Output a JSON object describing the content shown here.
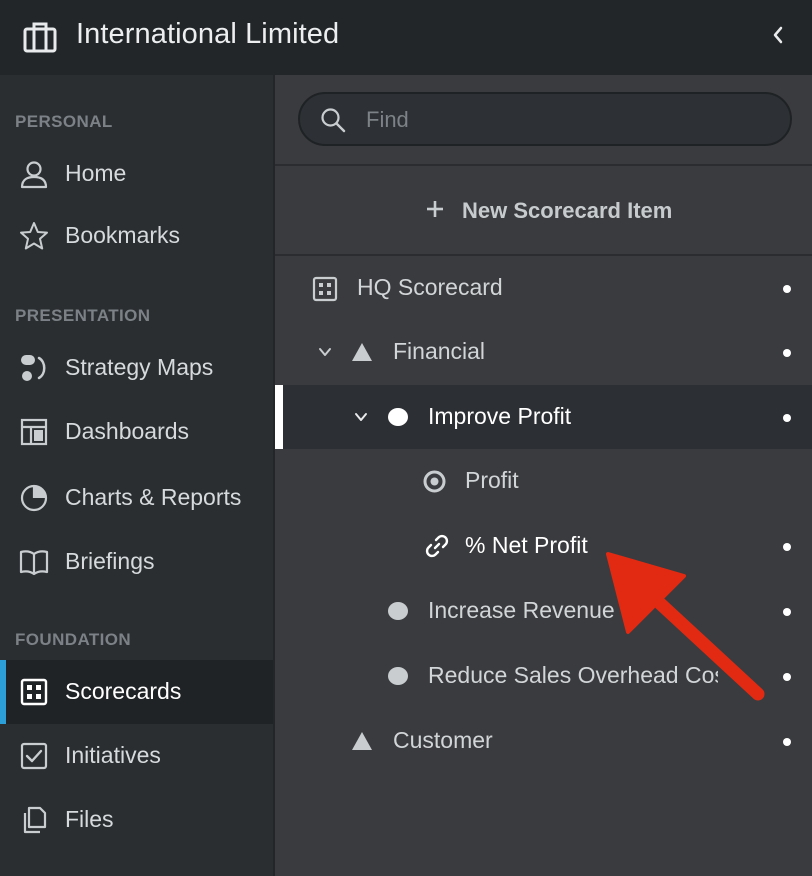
{
  "header": {
    "title": "International Limited",
    "app_icon": "briefcase-icon",
    "collapse_icon": "chevron-left-icon"
  },
  "sidebar": {
    "sections": [
      {
        "label": "PERSONAL"
      },
      {
        "label": "PRESENTATION"
      },
      {
        "label": "FOUNDATION"
      }
    ],
    "items": [
      {
        "label": "Home",
        "icon": "user-icon"
      },
      {
        "label": "Bookmarks",
        "icon": "star-icon"
      },
      {
        "label": "Strategy Maps",
        "icon": "strategy-map-icon"
      },
      {
        "label": "Dashboards",
        "icon": "dashboard-icon"
      },
      {
        "label": "Charts & Reports",
        "icon": "pie-chart-icon"
      },
      {
        "label": "Briefings",
        "icon": "book-icon"
      },
      {
        "label": "Scorecards",
        "icon": "scorecard-icon",
        "active": true
      },
      {
        "label": "Initiatives",
        "icon": "checkbox-icon"
      },
      {
        "label": "Files",
        "icon": "files-icon"
      }
    ],
    "accent_color": "#2c9ed8"
  },
  "main": {
    "search": {
      "placeholder": "Find",
      "value": ""
    },
    "new_item_label": "New Scorecard Item",
    "tree": [
      {
        "label": "HQ Scorecard",
        "icon": "scorecard-icon"
      },
      {
        "label": "Financial",
        "icon": "triangle-icon",
        "expanded": true
      },
      {
        "label": "Improve Profit",
        "icon": "circle-icon",
        "expanded": true,
        "selected": true
      },
      {
        "label": "Profit",
        "icon": "target-icon"
      },
      {
        "label": "% Net Profit",
        "icon": "link-icon"
      },
      {
        "label": "Increase Revenue",
        "icon": "circle-icon"
      },
      {
        "label": "Reduce Sales Overhead Costs",
        "icon": "circle-icon"
      },
      {
        "label": "Customer",
        "icon": "triangle-icon"
      }
    ],
    "annotation_arrow_color": "#e22a12"
  }
}
